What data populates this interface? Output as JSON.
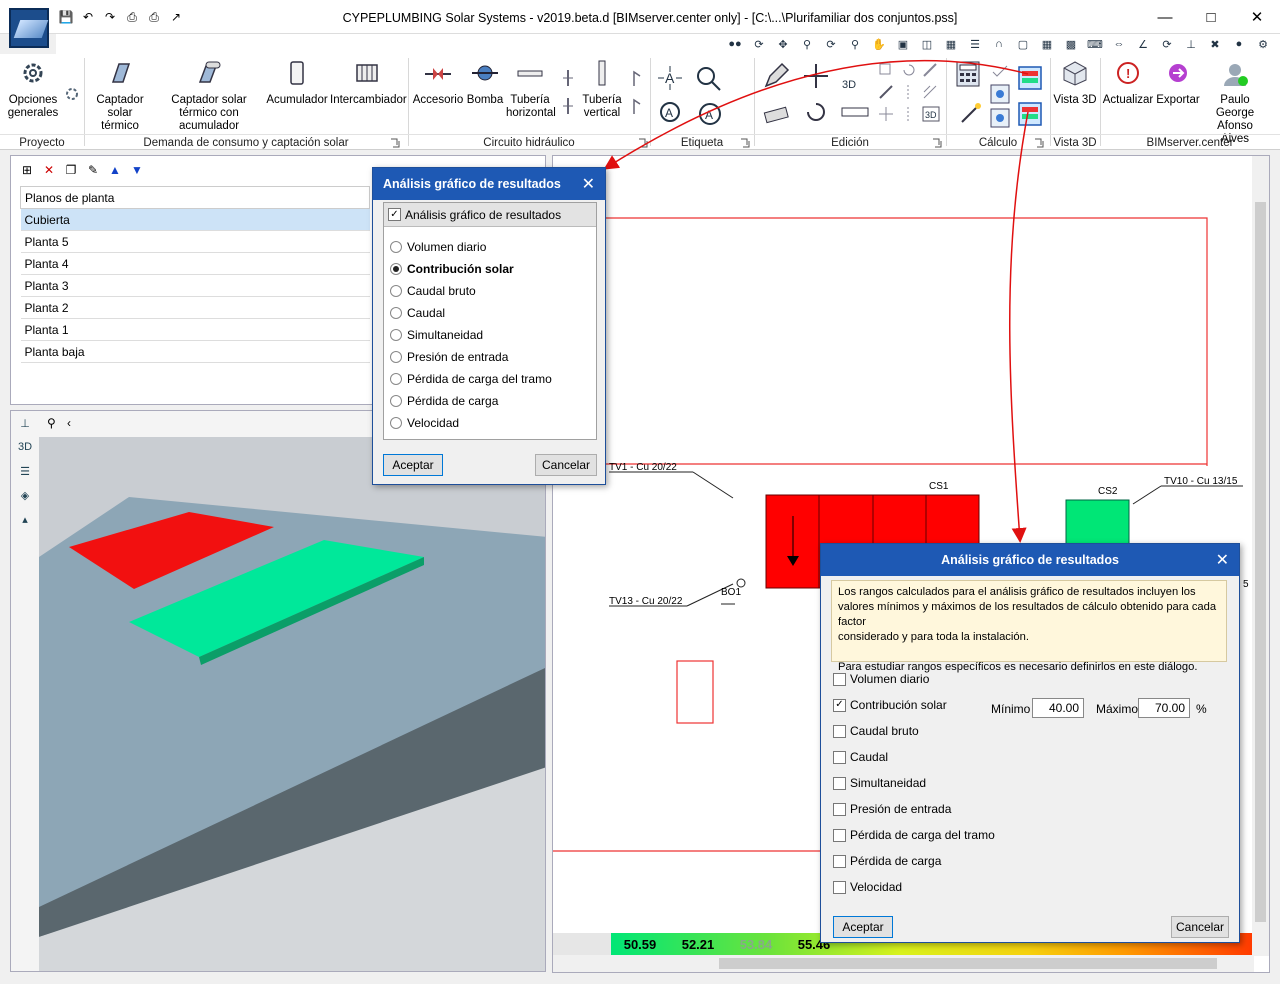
{
  "window": {
    "title": "CYPEPLUMBING Solar Systems - v2019.beta.d [BIMserver.center only] - [C:\\...\\Plurifamiliar dos conjuntos.pss]"
  },
  "ribbon": {
    "groups": {
      "proyecto": "Proyecto",
      "demanda": "Demanda de consumo y captación solar",
      "circuito": "Circuito hidráulico",
      "etiqueta": "Etiqueta",
      "edicion": "Edición",
      "calculo": "Cálculo",
      "vista3d": "Vista 3D",
      "bimserver": "BIMserver.center"
    },
    "buttons": {
      "opciones_generales": "Opciones generales",
      "captador_solar": "Captador solar térmico",
      "captador_acumulador": "Captador solar térmico con acumulador",
      "acumulador": "Acumulador",
      "intercambiador": "Intercambiador",
      "accesorio": "Accesorio",
      "bomba": "Bomba",
      "tuberia_horizontal": "Tubería horizontal",
      "tuberia_vertical": "Tubería vertical",
      "vista3d": "Vista 3D",
      "actualizar": "Actualizar",
      "exportar": "Exportar",
      "usuario": "Paulo George Afonso Alves"
    }
  },
  "floor_plans": {
    "header": "Planos de planta",
    "items": [
      "Cubierta",
      "Planta 5",
      "Planta 4",
      "Planta 3",
      "Planta 2",
      "Planta 1",
      "Planta baja"
    ],
    "selected": "Cubierta"
  },
  "plan": {
    "labels": {
      "tv1": "TV1 - Cu 20/22",
      "tv13": "TV13 - Cu 20/22",
      "tv10": "TV10 - Cu 13/15",
      "cs1": "CS1",
      "cs2": "CS2",
      "bo1": "BO1",
      "partial": "5"
    },
    "legend": [
      "50.59",
      "52.21",
      "53.84",
      "55.46"
    ],
    "legend_colors": [
      "#00e676",
      "#19f06a",
      "#4fe24a",
      "#8eea2a"
    ]
  },
  "dialog1": {
    "title": "Análisis gráfico de resultados",
    "checkbox_label": "Análisis gráfico de resultados",
    "options": [
      "Volumen diario",
      "Contribución solar",
      "Caudal bruto",
      "Caudal",
      "Simultaneidad",
      "Presión de entrada",
      "Pérdida de carga del tramo",
      "Pérdida de carga",
      "Velocidad"
    ],
    "selected": "Contribución solar",
    "ok": "Aceptar",
    "cancel": "Cancelar"
  },
  "dialog2": {
    "title": "Análisis gráfico de resultados",
    "info_line1": "Los rangos calculados para el análisis gráfico de resultados incluyen los",
    "info_line2": "valores mínimos y máximos de los resultados de cálculo obtenido para cada factor",
    "info_line3": "considerado y para toda la instalación.",
    "info_line4": "Para estudiar rangos específicos es necesario definirlos en este diálogo.",
    "options": [
      "Volumen diario",
      "Contribución solar",
      "Caudal bruto",
      "Caudal",
      "Simultaneidad",
      "Presión de entrada",
      "Pérdida de carga del tramo",
      "Pérdida de carga",
      "Velocidad"
    ],
    "checked": "Contribución solar",
    "min_label": "Mínimo",
    "min_value": "40.00",
    "max_label": "Máximo",
    "max_value": "70.00",
    "unit": "%",
    "ok": "Aceptar",
    "cancel": "Cancelar"
  },
  "colors": {
    "accent": "#1e59b4",
    "collector_red": "#ff0000",
    "collector_green": "#00e676"
  }
}
